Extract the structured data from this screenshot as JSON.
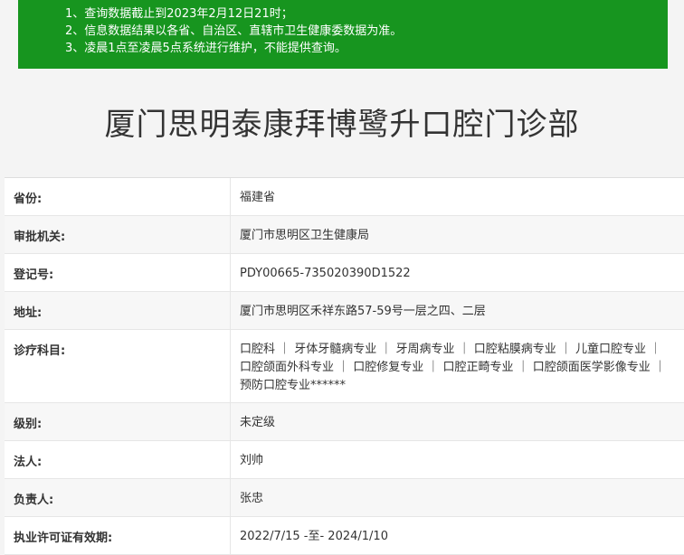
{
  "notice": {
    "lines": [
      "1、查询数据截止到2023年2月12日21时；",
      "2、信息数据结果以各省、自治区、直辖市卫生健康委数据为准。",
      "3、凌晨1点至凌晨5点系统进行维护，不能提供查询。"
    ]
  },
  "title": "厦门思明泰康拜博鹭升口腔门诊部",
  "rows": [
    {
      "label": "省份:",
      "value": "福建省"
    },
    {
      "label": "审批机关:",
      "value": "厦门市思明区卫生健康局"
    },
    {
      "label": "登记号:",
      "value": "PDY00665-735020390D1522"
    },
    {
      "label": "地址:",
      "value": "厦门市思明区禾祥东路57-59号一层之四、二层"
    },
    {
      "label": "诊疗科目:",
      "value": "口腔科 ｜ 牙体牙髓病专业 ｜ 牙周病专业 ｜ 口腔粘膜病专业 ｜ 儿童口腔专业 ｜ 口腔颌面外科专业 ｜ 口腔修复专业 ｜ 口腔正畸专业 ｜ 口腔颌面医学影像专业 ｜ 预防口腔专业******"
    },
    {
      "label": "级别:",
      "value": "未定级"
    },
    {
      "label": "法人:",
      "value": "刘帅"
    },
    {
      "label": "负责人:",
      "value": "张忠"
    },
    {
      "label": "执业许可证有效期:",
      "value": "2022/7/15 -至- 2024/1/10"
    }
  ]
}
